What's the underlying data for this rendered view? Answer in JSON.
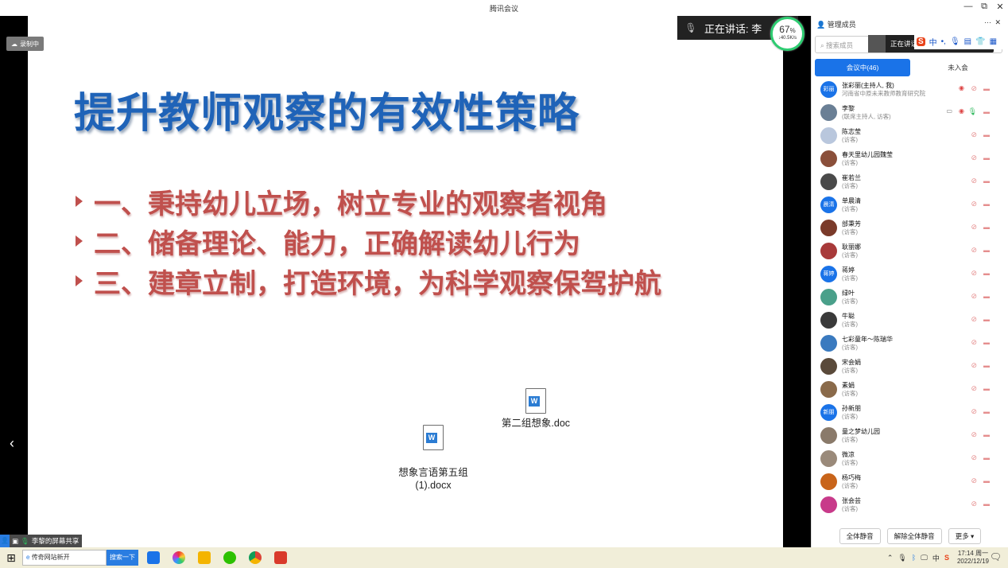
{
  "window": {
    "title": "腾讯会议",
    "minimize": "—",
    "restore": "⧉",
    "close": "✕"
  },
  "recording": {
    "label": "录制中"
  },
  "slide": {
    "title": "提升教师观察的有效性策略",
    "bullets": [
      "一、秉持幼儿立场，树立专业的观察者视角",
      "二、储备理论、能力，正确解读幼儿行为",
      "三、建章立制，打造环境，为科学观察保驾护航"
    ]
  },
  "desktop_files": [
    {
      "name": "第二组想象.doc",
      "icon": "word-doc-icon"
    },
    {
      "name": "想象言语第五组\n(1).docx",
      "icon": "word-doc-icon"
    }
  ],
  "speaking": {
    "label": "正在讲话: 李",
    "label2": "正在讲话"
  },
  "network": {
    "percent": "67",
    "unit": "%",
    "speed": "↓40.5K/s",
    "level": 0.67
  },
  "share_status": {
    "label": "李黎的屏幕共享"
  },
  "back_glyph": "‹",
  "panel": {
    "title": "管理成员",
    "more": "···",
    "close": "✕",
    "search_placeholder": "搜索成员",
    "tab_in_meeting": "会议中(46)",
    "tab_not_joined": "未入会",
    "members": [
      {
        "name": "张彩丽(主持人, 我)",
        "role": "河南省中原未来教师教育研究院",
        "avatar_text": "彩丽",
        "avatar_color": "#1a73e8",
        "host_icons": true
      },
      {
        "name": "李黎",
        "role": "(联席主持人, 访客)",
        "avatar_text": "",
        "avatar_color": "#6a7f95",
        "cohost": true
      },
      {
        "name": "陈志莹",
        "role": "(访客)",
        "avatar_text": "",
        "avatar_color": "#b9c7dd"
      },
      {
        "name": "春天里幼儿园魏莹",
        "role": "(访客)",
        "avatar_text": "",
        "avatar_color": "#8a4f3a"
      },
      {
        "name": "崔若兰",
        "role": "(访客)",
        "avatar_text": "",
        "avatar_color": "#4a4a4a"
      },
      {
        "name": "单晨清",
        "role": "(访客)",
        "avatar_text": "晨清",
        "avatar_color": "#1a73e8"
      },
      {
        "name": "邰秉芳",
        "role": "(访客)",
        "avatar_text": "",
        "avatar_color": "#7a3a2a"
      },
      {
        "name": "耿丽娜",
        "role": "(访客)",
        "avatar_text": "",
        "avatar_color": "#a83a3a"
      },
      {
        "name": "蒋婷",
        "role": "(访客)",
        "avatar_text": "蒋婷",
        "avatar_color": "#1a73e8"
      },
      {
        "name": "绿叶",
        "role": "(访客)",
        "avatar_text": "",
        "avatar_color": "#4aa08a"
      },
      {
        "name": "牛聪",
        "role": "(访客)",
        "avatar_text": "",
        "avatar_color": "#3a3a3a"
      },
      {
        "name": "七彩童年～陈瑞华",
        "role": "(访客)",
        "avatar_text": "",
        "avatar_color": "#3a7abf"
      },
      {
        "name": "宋会娟",
        "role": "(访客)",
        "avatar_text": "",
        "avatar_color": "#5a4a3a"
      },
      {
        "name": "素娟",
        "role": "(访客)",
        "avatar_text": "",
        "avatar_color": "#8a6a4a"
      },
      {
        "name": "孙新朋",
        "role": "(访客)",
        "avatar_text": "新朋",
        "avatar_color": "#1a73e8"
      },
      {
        "name": "童之梦幼儿园",
        "role": "(访客)",
        "avatar_text": "",
        "avatar_color": "#8a7a6a"
      },
      {
        "name": "微凉",
        "role": "(访客)",
        "avatar_text": "",
        "avatar_color": "#9a8a7a"
      },
      {
        "name": "杨巧梅",
        "role": "(访客)",
        "avatar_text": "",
        "avatar_color": "#c8641a"
      },
      {
        "name": "张会芸",
        "role": "(访客)",
        "avatar_text": "",
        "avatar_color": "#c83a8a"
      }
    ],
    "mute_all": "全体静音",
    "unmute_all": "解除全体静音",
    "more_btn": "更多 ▾"
  },
  "ime": {
    "cn": "中",
    "dot": "•,"
  },
  "taskbar": {
    "address": "传奇网站新开",
    "search_btn": "搜索一下",
    "tray_ime": "中",
    "time": "17:14 周一",
    "date": "2022/12/19"
  }
}
